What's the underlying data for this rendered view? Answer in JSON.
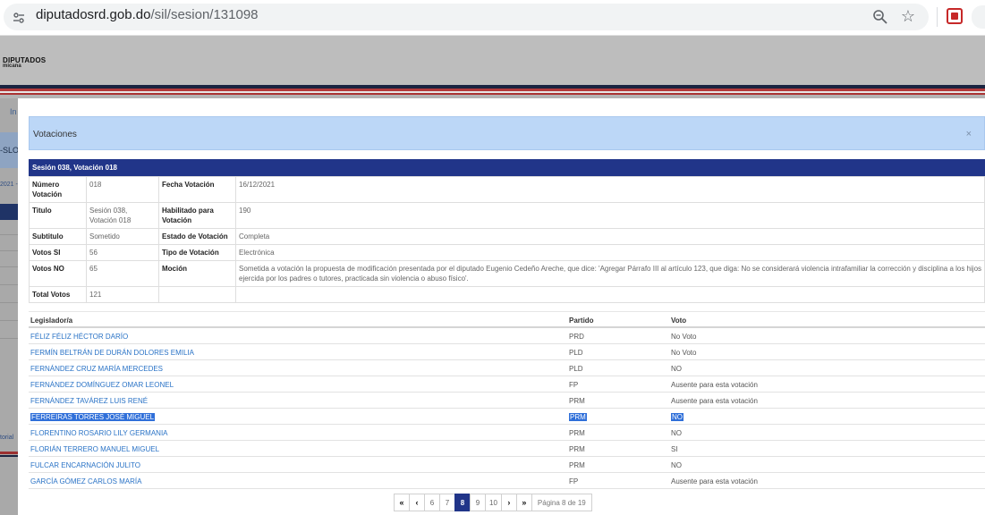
{
  "browser": {
    "url_domain": "diputadosrd.gob.do",
    "url_path": "/sil/sesion/131098",
    "star_glyph": "☆"
  },
  "background": {
    "logo_title": "DIPUTADOS",
    "logo_subtitle": "micana",
    "left_link": "In",
    "left_band_text": "-SLO",
    "left_date": "2021 -",
    "left_footer": "torial"
  },
  "modal": {
    "title": "Votaciones",
    "close_label": "×",
    "panel_title": "Sesión 038, Votación 018",
    "details": [
      [
        {
          "label": "Número Votación",
          "value": "018"
        },
        {
          "label": "Fecha Votación",
          "value": "16/12/2021"
        }
      ],
      [
        {
          "label": "Titulo",
          "value": "Sesión 038, Votación 018"
        },
        {
          "label": "Habilitado para Votación",
          "value": "190"
        }
      ],
      [
        {
          "label": "Subtitulo",
          "value": "Sometido"
        },
        {
          "label": "Estado de Votación",
          "value": "Completa"
        }
      ],
      [
        {
          "label": "Votos SI",
          "value": "56"
        },
        {
          "label": "Tipo de Votación",
          "value": "Electrónica"
        }
      ],
      [
        {
          "label": "Votos NO",
          "value": "65"
        },
        {
          "label": "Moción",
          "value": "Sometida a votación la propuesta de modificación presentada por el diputado Eugenio Cedeño Areche, que dice: 'Agregar Párrafo III al artículo 123, que diga: No se considerará violencia intrafamiliar la corrección y disciplina a los hijos ejercida por los padres o tutores, practicada sin violencia o abuso físico'."
        }
      ],
      [
        {
          "label": "Total Votos",
          "value": "121"
        },
        {
          "label": "",
          "value": ""
        }
      ]
    ],
    "votes_table": {
      "headers": {
        "legislator": "Legislador/a",
        "party": "Partido",
        "vote": "Voto"
      },
      "rows": [
        {
          "name": "FÉLIZ FÉLIZ HÉCTOR DARÍO",
          "party": "PRD",
          "vote": "No Voto",
          "selected": false
        },
        {
          "name": "FERMÍN BELTRÁN DE DURÁN DOLORES EMILIA",
          "party": "PLD",
          "vote": "No Voto",
          "selected": false
        },
        {
          "name": "FERNÁNDEZ CRUZ MARÍA MERCEDES",
          "party": "PLD",
          "vote": "NO",
          "selected": false
        },
        {
          "name": "FERNÁNDEZ DOMÍNGUEZ OMAR LEONEL",
          "party": "FP",
          "vote": "Ausente para esta votación",
          "selected": false
        },
        {
          "name": "FERNÁNDEZ TAVÁREZ LUIS RENÉ",
          "party": "PRM",
          "vote": "Ausente para esta votación",
          "selected": false
        },
        {
          "name": "FERREIRAS TORRES JOSÉ MIGUEL",
          "party": "PRM",
          "vote": "NO",
          "selected": true
        },
        {
          "name": "FLORENTINO ROSARIO LILY GERMANIA",
          "party": "PRM",
          "vote": "NO",
          "selected": false
        },
        {
          "name": "FLORIÁN TERRERO MANUEL MIGUEL",
          "party": "PRM",
          "vote": "SI",
          "selected": false
        },
        {
          "name": "FULCAR ENCARNACIÓN JULITO",
          "party": "PRM",
          "vote": "NO",
          "selected": false
        },
        {
          "name": "GARCÍA GÓMEZ CARLOS MARÍA",
          "party": "FP",
          "vote": "Ausente para esta votación",
          "selected": false
        }
      ]
    },
    "pagination": {
      "first": "«",
      "prev": "‹",
      "pages": [
        "6",
        "7",
        "8",
        "9",
        "10"
      ],
      "current": "8",
      "next": "›",
      "last": "»",
      "info": "Página 8 de 19"
    }
  }
}
